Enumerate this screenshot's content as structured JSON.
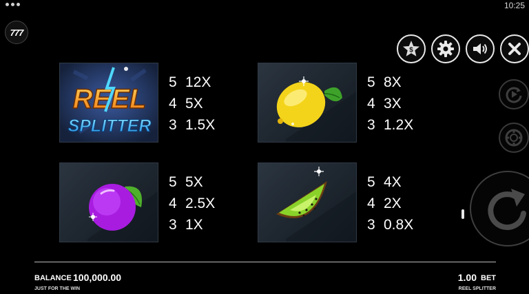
{
  "status": {
    "time": "10:25"
  },
  "logo": {
    "text": "777"
  },
  "controls": {
    "top": [
      {
        "name": "star-dollar-button",
        "icon": "star-dollar-icon"
      },
      {
        "name": "settings-button",
        "icon": "gear-icon"
      },
      {
        "name": "sound-button",
        "icon": "speaker-icon"
      },
      {
        "name": "close-button",
        "icon": "close-icon"
      }
    ],
    "side": [
      {
        "name": "autoplay-button",
        "icon": "autoplay-icon"
      },
      {
        "name": "bet-chip-button",
        "icon": "chip-icon"
      },
      {
        "name": "spin-button",
        "icon": "spin-arrow-icon"
      }
    ]
  },
  "paytable": [
    {
      "symbol": "reel-splitter-logo",
      "logo_lines": [
        "REEL",
        "SPLITTER"
      ],
      "rows": [
        {
          "n": "5",
          "mult": "12X"
        },
        {
          "n": "4",
          "mult": "5X"
        },
        {
          "n": "3",
          "mult": "1.5X"
        }
      ]
    },
    {
      "symbol": "lemon",
      "rows": [
        {
          "n": "5",
          "mult": "8X"
        },
        {
          "n": "4",
          "mult": "3X"
        },
        {
          "n": "3",
          "mult": "1.2X"
        }
      ]
    },
    {
      "symbol": "plum",
      "rows": [
        {
          "n": "5",
          "mult": "5X"
        },
        {
          "n": "4",
          "mult": "2.5X"
        },
        {
          "n": "3",
          "mult": "1X"
        }
      ]
    },
    {
      "symbol": "kiwi",
      "rows": [
        {
          "n": "5",
          "mult": "4X"
        },
        {
          "n": "4",
          "mult": "2X"
        },
        {
          "n": "3",
          "mult": "0.8X"
        }
      ]
    }
  ],
  "footer": {
    "balance_label": "BALANCE",
    "balance_value": "100,000.00",
    "brand_left": "JUST FOR THE WIN",
    "bet_value": "1.00",
    "bet_label": "BET",
    "brand_right": "REEL SPLITTER"
  },
  "colors": {
    "background": "#000000",
    "logo_orange": "#f5a623",
    "logo_blue": "#29b6f6",
    "lemon": "#f7e11b",
    "plum": "#b620e8",
    "kiwi": "#7ec820",
    "leaf": "#4caf2a"
  }
}
